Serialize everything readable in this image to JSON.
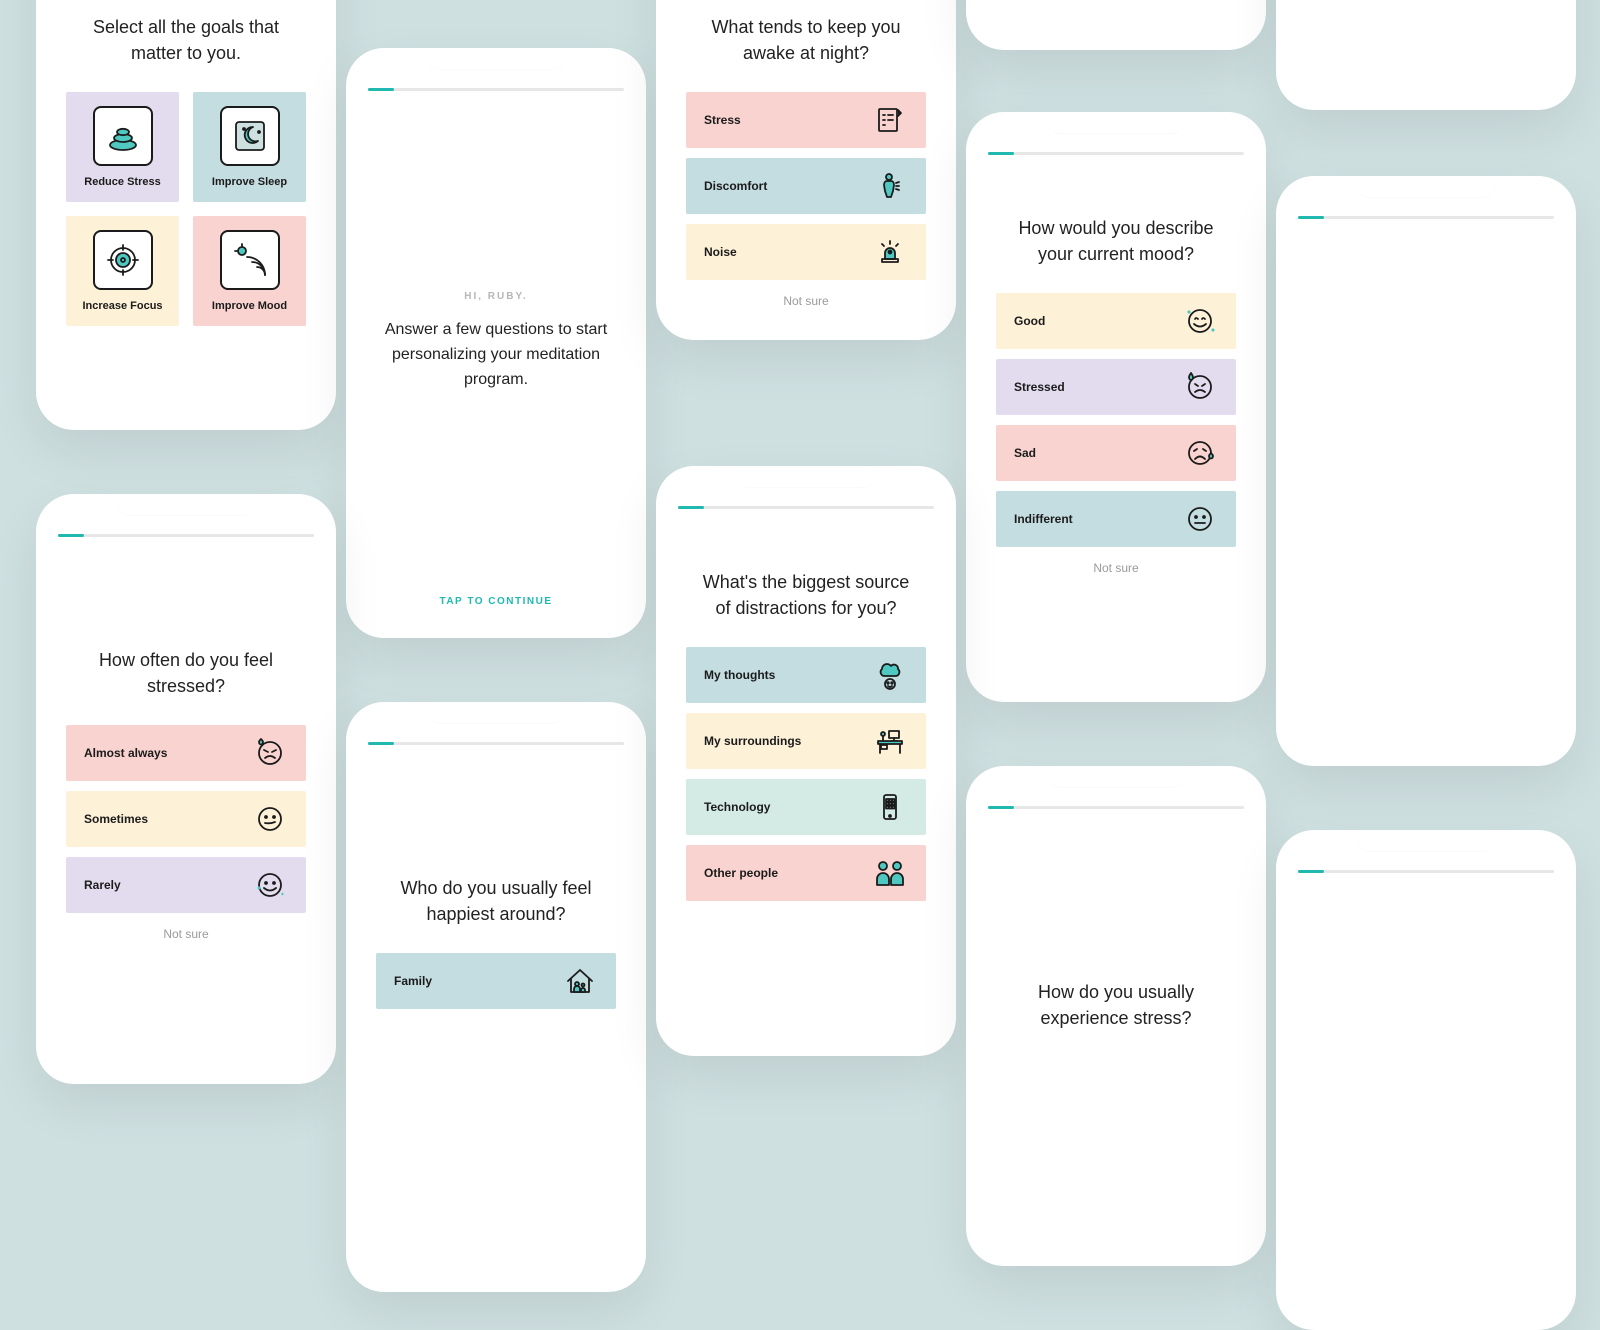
{
  "screens": {
    "goals": {
      "title": "Select all the goals that matter to you.",
      "items": [
        {
          "label": "Reduce Stress"
        },
        {
          "label": "Improve Sleep"
        },
        {
          "label": "Increase Focus"
        },
        {
          "label": "Improve Mood"
        }
      ]
    },
    "intro": {
      "greeting": "HI, RUBY.",
      "body": "Answer a few questions to start personalizing your meditation program.",
      "cta": "TAP TO CONTINUE"
    },
    "awake": {
      "title": "What tends to keep you awake at night?",
      "options": [
        {
          "label": "Stress"
        },
        {
          "label": "Discomfort"
        },
        {
          "label": "Noise"
        }
      ],
      "not_sure": "Not sure"
    },
    "mood": {
      "title": "How would you describe your current mood?",
      "options": [
        {
          "label": "Good"
        },
        {
          "label": "Stressed"
        },
        {
          "label": "Sad"
        },
        {
          "label": "Indifferent"
        }
      ],
      "not_sure": "Not sure"
    },
    "stress_freq": {
      "title": "How often do you feel stressed?",
      "options": [
        {
          "label": "Almost always"
        },
        {
          "label": "Sometimes"
        },
        {
          "label": "Rarely"
        }
      ],
      "not_sure": "Not sure"
    },
    "happiest": {
      "title": "Who do you usually feel happiest around?",
      "options": [
        {
          "label": "Family"
        }
      ]
    },
    "distractions": {
      "title": "What's the biggest source of distractions for you?",
      "options": [
        {
          "label": "My thoughts"
        },
        {
          "label": "My surroundings"
        },
        {
          "label": "Technology"
        },
        {
          "label": "Other people"
        }
      ]
    },
    "experience_stress": {
      "title": "How do you usually experience stress?"
    }
  },
  "colors": {
    "accent": "#1fb9b0",
    "pink": "#f9d3cf",
    "blue": "#c4dde1",
    "cream": "#fdf1d8",
    "lilac": "#e2dcee",
    "mint": "#d4eae4"
  }
}
